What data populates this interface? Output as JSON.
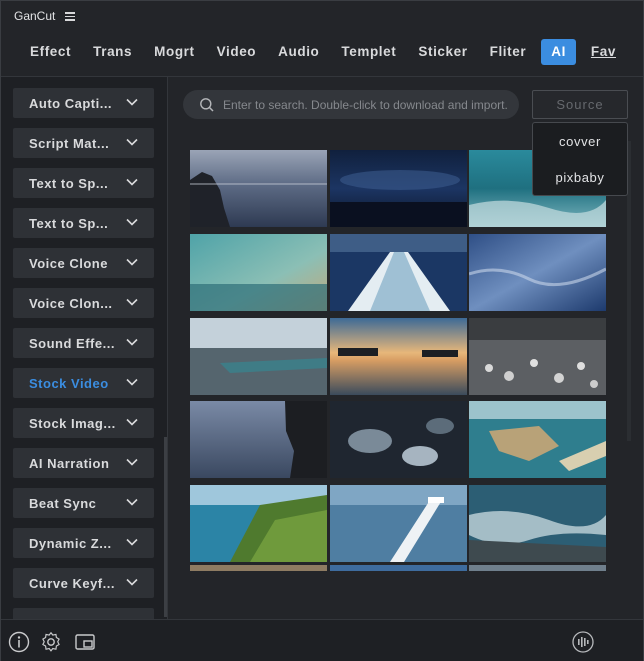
{
  "app": {
    "title": "GanCut"
  },
  "tabs": [
    {
      "label": "Effect"
    },
    {
      "label": "Trans"
    },
    {
      "label": "Mogrt"
    },
    {
      "label": "Video"
    },
    {
      "label": "Audio"
    },
    {
      "label": "Templet"
    },
    {
      "label": "Sticker"
    },
    {
      "label": "Fliter"
    },
    {
      "label": "AI",
      "active": true
    },
    {
      "label": "Fav"
    }
  ],
  "sidebar": {
    "items": [
      {
        "label": "Auto Capti..."
      },
      {
        "label": "Script Mat..."
      },
      {
        "label": "Text to Sp..."
      },
      {
        "label": "Text to Sp..."
      },
      {
        "label": "Voice Clone"
      },
      {
        "label": "Voice Clon..."
      },
      {
        "label": "Sound Effe..."
      },
      {
        "label": "Stock Video",
        "selected": true
      },
      {
        "label": "Stock Imag..."
      },
      {
        "label": "AI Narration"
      },
      {
        "label": "Beat Sync"
      },
      {
        "label": "Dynamic Z..."
      },
      {
        "label": "Curve Keyf..."
      }
    ]
  },
  "search": {
    "placeholder": "Enter to search. Double-click to download and import.",
    "value": ""
  },
  "source": {
    "label": "Source",
    "options": [
      "covver",
      "pixbaby"
    ]
  },
  "thumbnails": [
    "sea-rock-sunset",
    "night-ocean-clouds",
    "ocean-waves-surface",
    "teal-sea-boat",
    "ship-wake",
    "blue-water-waves",
    "harbor-aerial",
    "pier-sunset",
    "white-stone-beach",
    "coastal-rock-dusk",
    "wet-rocks",
    "river-delta-aerial",
    "tropical-palms-coast",
    "white-railing-sea",
    "rocky-shore-surf"
  ],
  "colors": {
    "accent": "#3b8de0",
    "background": "#232529",
    "panel": "#1e2024"
  },
  "icons": [
    "menu-icon",
    "chevron-down-icon",
    "search-icon",
    "info-icon",
    "settings-icon",
    "window-icon",
    "audio-wave-icon"
  ]
}
